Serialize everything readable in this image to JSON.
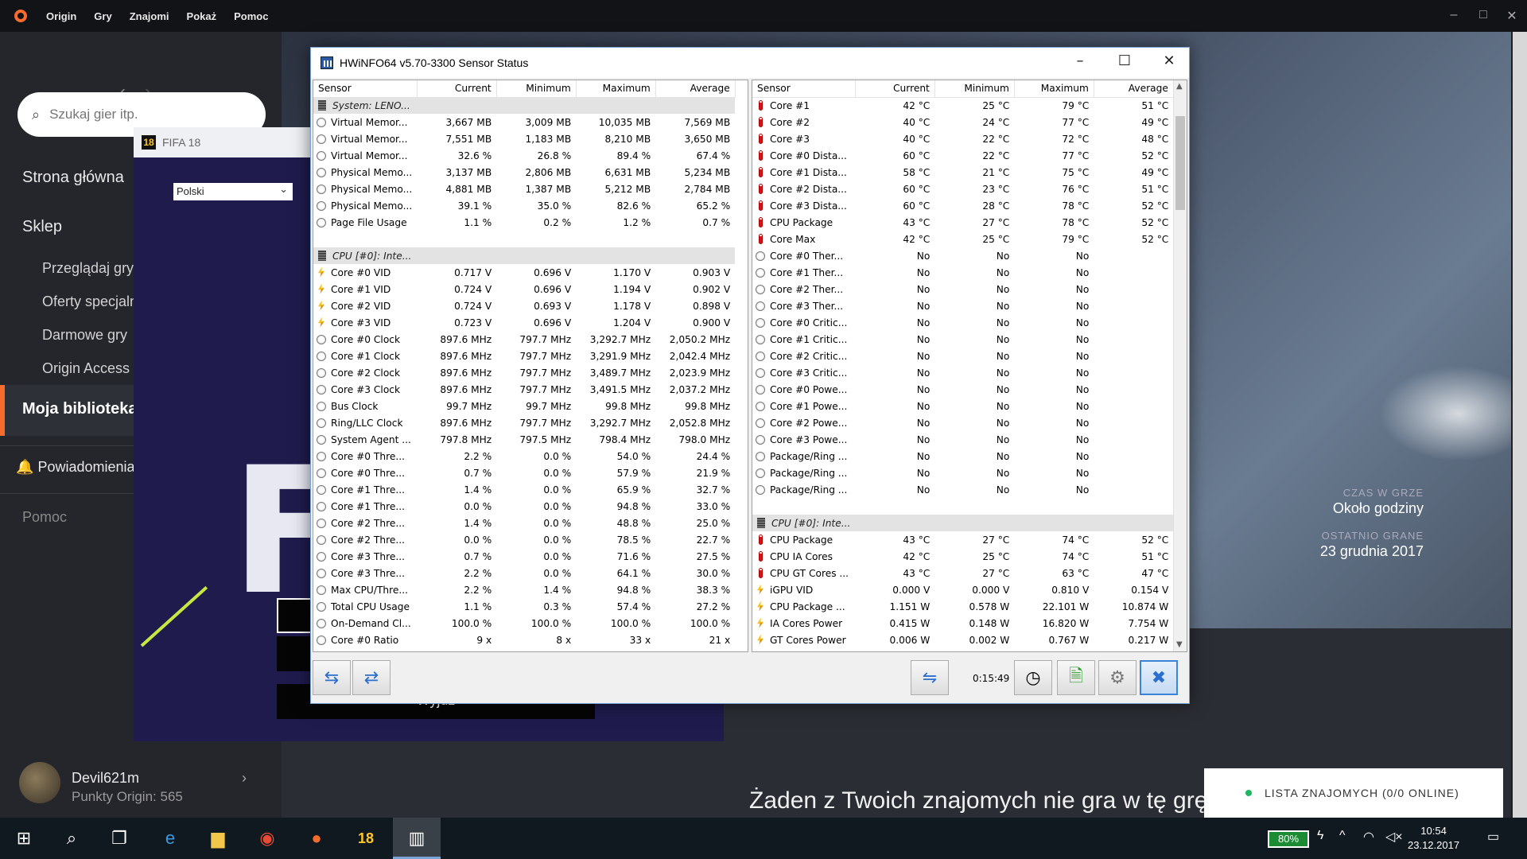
{
  "origin": {
    "menu": [
      "Origin",
      "Gry",
      "Znajomi",
      "Pokaż",
      "Pomoc"
    ],
    "search_placeholder": "Szukaj gier itp.",
    "nav": {
      "home": "Strona główna",
      "store": "Sklep",
      "browse": "Przeglądaj gry",
      "deals": "Oferty specjalne",
      "free": "Darmowe gry",
      "access": "Origin Access",
      "library": "Moja biblioteka",
      "notifications": "Powiadomienia",
      "help": "Pomoc"
    },
    "user": {
      "name": "Devil621m",
      "points": "Punkty Origin: 565"
    },
    "game_info": {
      "playtime_label": "CZAS W GRZE",
      "playtime_value": "Około godziny",
      "last_played_label": "OSTATNIO GRANE",
      "last_played_value": "23 grudnia 2017"
    },
    "no_friends_text": "Żaden z Twoich znajomych nie gra w tę grę",
    "friends_list": "LISTA ZNAJOMYCH (0/0 ONLINE)",
    "accent_color": "#f56c2d"
  },
  "fifa": {
    "title": "FIFA 18",
    "icon_text": "18",
    "language": "Polski",
    "big_letter": "F",
    "exit_label": "Wyjdź"
  },
  "hwinfo": {
    "title": "HWiNFO64 v5.70-3300 Sensor Status",
    "columns": [
      "Sensor",
      "Current",
      "Minimum",
      "Maximum",
      "Average"
    ],
    "elapsed": "0:15:49",
    "left_rows": [
      {
        "group": true,
        "name": "System: LENO..."
      },
      {
        "icon": "clock",
        "name": "Virtual Memor...",
        "v": [
          "3,667 MB",
          "3,009 MB",
          "10,035 MB",
          "7,569 MB"
        ]
      },
      {
        "icon": "clock",
        "name": "Virtual Memor...",
        "v": [
          "7,551 MB",
          "1,183 MB",
          "8,210 MB",
          "3,650 MB"
        ]
      },
      {
        "icon": "clock",
        "name": "Virtual Memor...",
        "v": [
          "32.6 %",
          "26.8 %",
          "89.4 %",
          "67.4 %"
        ]
      },
      {
        "icon": "clock",
        "name": "Physical Memo...",
        "v": [
          "3,137 MB",
          "2,806 MB",
          "6,631 MB",
          "5,234 MB"
        ]
      },
      {
        "icon": "clock",
        "name": "Physical Memo...",
        "v": [
          "4,881 MB",
          "1,387 MB",
          "5,212 MB",
          "2,784 MB"
        ]
      },
      {
        "icon": "clock",
        "name": "Physical Memo...",
        "v": [
          "39.1 %",
          "35.0 %",
          "82.6 %",
          "65.2 %"
        ]
      },
      {
        "icon": "clock",
        "name": "Page File Usage",
        "v": [
          "1.1 %",
          "0.2 %",
          "1.2 %",
          "0.7 %"
        ]
      },
      {
        "blank": true
      },
      {
        "group": true,
        "name": "CPU [#0]: Inte..."
      },
      {
        "icon": "volt",
        "name": "Core #0 VID",
        "v": [
          "0.717 V",
          "0.696 V",
          "1.170 V",
          "0.903 V"
        ]
      },
      {
        "icon": "volt",
        "name": "Core #1 VID",
        "v": [
          "0.724 V",
          "0.696 V",
          "1.194 V",
          "0.902 V"
        ]
      },
      {
        "icon": "volt",
        "name": "Core #2 VID",
        "v": [
          "0.724 V",
          "0.693 V",
          "1.178 V",
          "0.898 V"
        ]
      },
      {
        "icon": "volt",
        "name": "Core #3 VID",
        "v": [
          "0.723 V",
          "0.696 V",
          "1.204 V",
          "0.900 V"
        ]
      },
      {
        "icon": "clock",
        "name": "Core #0 Clock",
        "v": [
          "897.6 MHz",
          "797.7 MHz",
          "3,292.7 MHz",
          "2,050.2 MHz"
        ]
      },
      {
        "icon": "clock",
        "name": "Core #1 Clock",
        "v": [
          "897.6 MHz",
          "797.7 MHz",
          "3,291.9 MHz",
          "2,042.4 MHz"
        ]
      },
      {
        "icon": "clock",
        "name": "Core #2 Clock",
        "v": [
          "897.6 MHz",
          "797.7 MHz",
          "3,489.7 MHz",
          "2,023.9 MHz"
        ]
      },
      {
        "icon": "clock",
        "name": "Core #3 Clock",
        "v": [
          "897.6 MHz",
          "797.7 MHz",
          "3,491.5 MHz",
          "2,037.2 MHz"
        ]
      },
      {
        "icon": "clock",
        "name": "Bus Clock",
        "v": [
          "99.7 MHz",
          "99.7 MHz",
          "99.8 MHz",
          "99.8 MHz"
        ]
      },
      {
        "icon": "clock",
        "name": "Ring/LLC Clock",
        "v": [
          "897.6 MHz",
          "797.7 MHz",
          "3,292.7 MHz",
          "2,052.8 MHz"
        ]
      },
      {
        "icon": "clock",
        "name": "System Agent ...",
        "v": [
          "797.8 MHz",
          "797.5 MHz",
          "798.4 MHz",
          "798.0 MHz"
        ]
      },
      {
        "icon": "clock",
        "name": "Core #0 Thre...",
        "v": [
          "2.2 %",
          "0.0 %",
          "54.0 %",
          "24.4 %"
        ]
      },
      {
        "icon": "clock",
        "name": "Core #0 Thre...",
        "v": [
          "0.7 %",
          "0.0 %",
          "57.9 %",
          "21.9 %"
        ]
      },
      {
        "icon": "clock",
        "name": "Core #1 Thre...",
        "v": [
          "1.4 %",
          "0.0 %",
          "65.9 %",
          "32.7 %"
        ]
      },
      {
        "icon": "clock",
        "name": "Core #1 Thre...",
        "v": [
          "0.0 %",
          "0.0 %",
          "94.8 %",
          "33.0 %"
        ]
      },
      {
        "icon": "clock",
        "name": "Core #2 Thre...",
        "v": [
          "1.4 %",
          "0.0 %",
          "48.8 %",
          "25.0 %"
        ]
      },
      {
        "icon": "clock",
        "name": "Core #2 Thre...",
        "v": [
          "0.0 %",
          "0.0 %",
          "78.5 %",
          "22.7 %"
        ]
      },
      {
        "icon": "clock",
        "name": "Core #3 Thre...",
        "v": [
          "0.7 %",
          "0.0 %",
          "71.6 %",
          "27.5 %"
        ]
      },
      {
        "icon": "clock",
        "name": "Core #3 Thre...",
        "v": [
          "2.2 %",
          "0.0 %",
          "64.1 %",
          "30.0 %"
        ]
      },
      {
        "icon": "clock",
        "name": "Max CPU/Thre...",
        "v": [
          "2.2 %",
          "1.4 %",
          "94.8 %",
          "38.3 %"
        ]
      },
      {
        "icon": "clock",
        "name": "Total CPU Usage",
        "v": [
          "1.1 %",
          "0.3 %",
          "57.4 %",
          "27.2 %"
        ]
      },
      {
        "icon": "clock",
        "name": "On-Demand Cl...",
        "v": [
          "100.0 %",
          "100.0 %",
          "100.0 %",
          "100.0 %"
        ]
      },
      {
        "icon": "clock",
        "name": "Core #0 Ratio",
        "v": [
          "9 x",
          "8 x",
          "33 x",
          "21 x"
        ]
      }
    ],
    "right_rows": [
      {
        "icon": "temp",
        "name": "Core #1",
        "v": [
          "42 °C",
          "25 °C",
          "79 °C",
          "51 °C"
        ]
      },
      {
        "icon": "temp",
        "name": "Core #2",
        "v": [
          "40 °C",
          "24 °C",
          "77 °C",
          "49 °C"
        ]
      },
      {
        "icon": "temp",
        "name": "Core #3",
        "v": [
          "40 °C",
          "22 °C",
          "72 °C",
          "48 °C"
        ]
      },
      {
        "icon": "temp",
        "name": "Core #0 Dista...",
        "v": [
          "60 °C",
          "22 °C",
          "77 °C",
          "52 °C"
        ]
      },
      {
        "icon": "temp",
        "name": "Core #1 Dista...",
        "v": [
          "58 °C",
          "21 °C",
          "75 °C",
          "49 °C"
        ]
      },
      {
        "icon": "temp",
        "name": "Core #2 Dista...",
        "v": [
          "60 °C",
          "23 °C",
          "76 °C",
          "51 °C"
        ]
      },
      {
        "icon": "temp",
        "name": "Core #3 Dista...",
        "v": [
          "60 °C",
          "28 °C",
          "78 °C",
          "52 °C"
        ]
      },
      {
        "icon": "temp",
        "name": "CPU Package",
        "v": [
          "43 °C",
          "27 °C",
          "78 °C",
          "52 °C"
        ]
      },
      {
        "icon": "temp",
        "name": "Core Max",
        "v": [
          "42 °C",
          "25 °C",
          "79 °C",
          "52 °C"
        ]
      },
      {
        "icon": "clock",
        "name": "Core #0 Ther...",
        "v": [
          "No",
          "No",
          "No",
          ""
        ]
      },
      {
        "icon": "clock",
        "name": "Core #1 Ther...",
        "v": [
          "No",
          "No",
          "No",
          ""
        ]
      },
      {
        "icon": "clock",
        "name": "Core #2 Ther...",
        "v": [
          "No",
          "No",
          "No",
          ""
        ]
      },
      {
        "icon": "clock",
        "name": "Core #3 Ther...",
        "v": [
          "No",
          "No",
          "No",
          ""
        ]
      },
      {
        "icon": "clock",
        "name": "Core #0 Critic...",
        "v": [
          "No",
          "No",
          "No",
          ""
        ]
      },
      {
        "icon": "clock",
        "name": "Core #1 Critic...",
        "v": [
          "No",
          "No",
          "No",
          ""
        ]
      },
      {
        "icon": "clock",
        "name": "Core #2 Critic...",
        "v": [
          "No",
          "No",
          "No",
          ""
        ]
      },
      {
        "icon": "clock",
        "name": "Core #3 Critic...",
        "v": [
          "No",
          "No",
          "No",
          ""
        ]
      },
      {
        "icon": "clock",
        "name": "Core #0 Powe...",
        "v": [
          "No",
          "No",
          "No",
          ""
        ]
      },
      {
        "icon": "clock",
        "name": "Core #1 Powe...",
        "v": [
          "No",
          "No",
          "No",
          ""
        ]
      },
      {
        "icon": "clock",
        "name": "Core #2 Powe...",
        "v": [
          "No",
          "No",
          "No",
          ""
        ]
      },
      {
        "icon": "clock",
        "name": "Core #3 Powe...",
        "v": [
          "No",
          "No",
          "No",
          ""
        ]
      },
      {
        "icon": "clock",
        "name": "Package/Ring ...",
        "v": [
          "No",
          "No",
          "No",
          ""
        ]
      },
      {
        "icon": "clock",
        "name": "Package/Ring ...",
        "v": [
          "No",
          "No",
          "No",
          ""
        ]
      },
      {
        "icon": "clock",
        "name": "Package/Ring ...",
        "v": [
          "No",
          "No",
          "No",
          ""
        ]
      },
      {
        "blank": true
      },
      {
        "group": true,
        "name": "CPU [#0]: Inte..."
      },
      {
        "icon": "temp",
        "name": "CPU Package",
        "v": [
          "43 °C",
          "27 °C",
          "74 °C",
          "52 °C"
        ]
      },
      {
        "icon": "temp",
        "name": "CPU IA Cores",
        "v": [
          "42 °C",
          "25 °C",
          "74 °C",
          "51 °C"
        ]
      },
      {
        "icon": "temp",
        "name": "CPU GT Cores ...",
        "v": [
          "43 °C",
          "27 °C",
          "63 °C",
          "47 °C"
        ]
      },
      {
        "icon": "volt",
        "name": "iGPU VID",
        "v": [
          "0.000 V",
          "0.000 V",
          "0.810 V",
          "0.154 V"
        ]
      },
      {
        "icon": "volt",
        "name": "CPU Package ...",
        "v": [
          "1.151 W",
          "0.578 W",
          "22.101 W",
          "10.874 W"
        ]
      },
      {
        "icon": "volt",
        "name": "IA Cores Power",
        "v": [
          "0.415 W",
          "0.148 W",
          "16.820 W",
          "7.754 W"
        ]
      },
      {
        "icon": "volt",
        "name": "GT Cores Power",
        "v": [
          "0.006 W",
          "0.002 W",
          "0.767 W",
          "0.217 W"
        ]
      }
    ]
  },
  "taskbar": {
    "battery": "80%",
    "time": "10:54",
    "date": "23.12.2017"
  }
}
